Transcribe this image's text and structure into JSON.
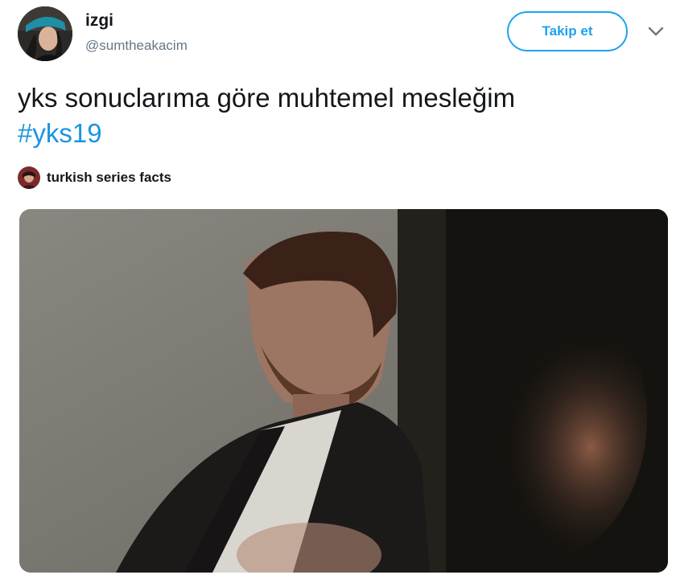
{
  "author": {
    "display_name": "izgi",
    "handle": "@sumtheakacim",
    "avatar_icon": "profile-photo"
  },
  "header": {
    "follow_label": "Takip et",
    "menu_icon": "chevron-down-icon"
  },
  "tweet": {
    "text": "yks sonuclarıma göre muhtemel mesleğim",
    "hashtag": "#yks19"
  },
  "source": {
    "name": "turkish series facts",
    "avatar_icon": "source-profile-photo"
  },
  "media": {
    "type": "video-still",
    "description_icon": "man-in-suit-photo"
  },
  "colors": {
    "accent": "#1da1f2",
    "hashtag": "#1b95e0",
    "text": "#14171a",
    "secondary_text": "#657786"
  }
}
